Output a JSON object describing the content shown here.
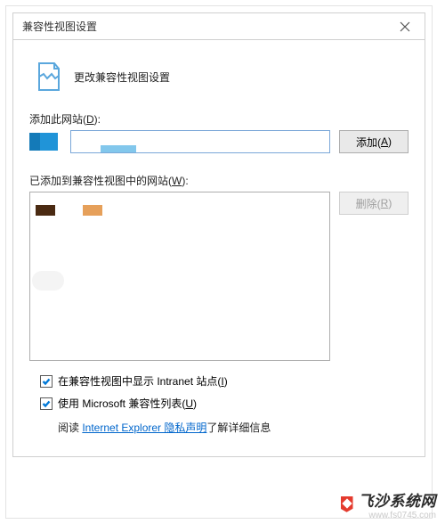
{
  "dialog": {
    "title": "兼容性视图设置",
    "close_tooltip": "关闭",
    "header": "更改兼容性视图设置",
    "add_section": {
      "label_prefix": "添加此网站(",
      "label_key": "D",
      "label_suffix": "):",
      "input_value": "",
      "button_prefix": "添加(",
      "button_key": "A",
      "button_suffix": ")"
    },
    "list_section": {
      "label_prefix": "已添加到兼容性视图中的网站(",
      "label_key": "W",
      "label_suffix": "):",
      "remove_prefix": "删除(",
      "remove_key": "R",
      "remove_suffix": ")"
    },
    "options": {
      "intranet": {
        "checked": true,
        "label_prefix": "在兼容性视图中显示 Intranet 站点(",
        "label_key": "I",
        "label_suffix": ")"
      },
      "ms_list": {
        "checked": true,
        "label_prefix": "使用 Microsoft 兼容性列表(",
        "label_key": "U",
        "label_suffix": ")"
      }
    },
    "info": {
      "prefix": "阅读 ",
      "link": "Internet Explorer 隐私声明",
      "suffix": "了解详细信息"
    }
  },
  "watermark": {
    "title": "飞沙系统网",
    "url": "www.fs0745.com"
  },
  "colors": {
    "accent": "#0078d7",
    "link": "#0066cc",
    "input_border": "#7aa7d8"
  }
}
